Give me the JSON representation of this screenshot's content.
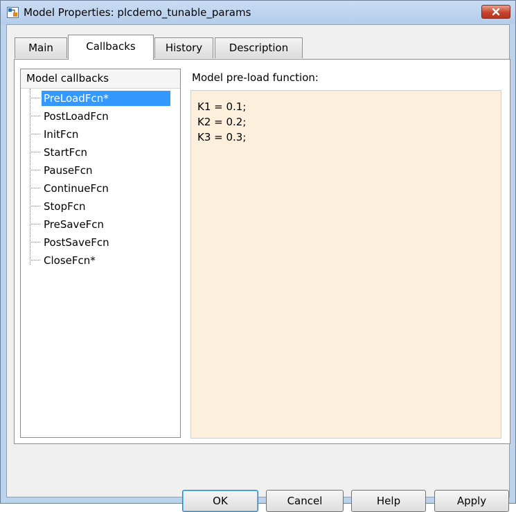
{
  "window": {
    "title": "Model Properties: plcdemo_tunable_params",
    "accent_colors": {
      "titlebar": "#bcd3ee",
      "close_button": "#c7452d",
      "selection": "#3399ff",
      "code_background": "#fcf0dd"
    }
  },
  "tabs": [
    {
      "label": "Main",
      "selected": false
    },
    {
      "label": "Callbacks",
      "selected": true
    },
    {
      "label": "History",
      "selected": false
    },
    {
      "label": "Description",
      "selected": false
    }
  ],
  "callbacks_list": {
    "header": "Model callbacks",
    "items": [
      {
        "label": "PreLoadFcn*",
        "selected": true
      },
      {
        "label": "PostLoadFcn",
        "selected": false
      },
      {
        "label": "InitFcn",
        "selected": false
      },
      {
        "label": "StartFcn",
        "selected": false
      },
      {
        "label": "PauseFcn",
        "selected": false
      },
      {
        "label": "ContinueFcn",
        "selected": false
      },
      {
        "label": "StopFcn",
        "selected": false
      },
      {
        "label": "PreSaveFcn",
        "selected": false
      },
      {
        "label": "PostSaveFcn",
        "selected": false
      },
      {
        "label": "CloseFcn*",
        "selected": false
      }
    ]
  },
  "editor": {
    "label": "Model pre-load function:",
    "lines": [
      "K1 = 0.1;",
      "K2 = 0.2;",
      "K3 = 0.3;"
    ]
  },
  "buttons": {
    "ok": "OK",
    "cancel": "Cancel",
    "help": "Help",
    "apply": "Apply"
  },
  "icons": [
    "simulink-model-icon",
    "close-icon"
  ]
}
